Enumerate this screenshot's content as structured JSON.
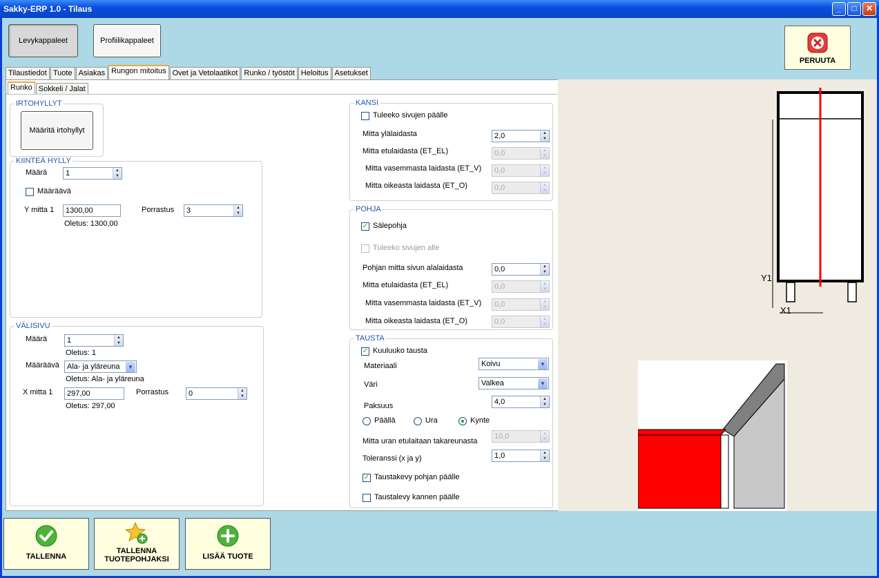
{
  "window": {
    "title": "Sakky-ERP 1.0 - Tilaus"
  },
  "top_buttons": {
    "levy": "Levykappaleet",
    "profiili": "Profiilikappaleet",
    "peruuta": "PERUUTA"
  },
  "main_tabs": [
    "Tilaustiedot",
    "Tuote",
    "Asiakas",
    "Rungon mitoitus",
    "Ovet ja Vetolaatikot",
    "Runko / työstöt",
    "Heloitus",
    "Asetukset"
  ],
  "sub_tabs": [
    "Runko",
    "Sokkeli / Jalat"
  ],
  "irtohyllyt": {
    "title": "IRTOHYLLYT",
    "button": "Määritä irtohyllyt"
  },
  "kiintea": {
    "title": "KIINTEÄ HYLLY",
    "maara_label": "Määrä",
    "maara_value": "1",
    "maaraava_label": "Määräävä",
    "ymitta_label": "Y mitta 1",
    "ymitta_value": "1300,00",
    "porrastus_label": "Porrastus",
    "porrastus_value": "3",
    "oletus": "Oletus: 1300,00"
  },
  "valisivu": {
    "title": "VÄLISIVU",
    "maara_label": "Määrä",
    "maara_value": "1",
    "maara_oletus": "Oletus: 1",
    "maaraava_label": "Määräävä",
    "maaraava_value": "Ala- ja yläreuna",
    "maaraava_oletus": "Oletus: Ala- ja yläreuna",
    "xmitta_label": "X mitta 1",
    "xmitta_value": "297,00",
    "porrastus_label": "Porrastus",
    "porrastus_value": "0",
    "xmitta_oletus": "Oletus: 297,00"
  },
  "kansi": {
    "title": "KANSI",
    "tuleeko": "Tuleeko sivujen päälle",
    "rows": [
      {
        "label": "Mitta ylälaidasta",
        "value": "2,0"
      },
      {
        "label": "Mitta etulaidasta (ET_EL)",
        "value": "0,0"
      },
      {
        "label": "Mitta vasemmasta laidasta (ET_V)",
        "value": "0,0"
      },
      {
        "label": "Mitta oikeasta laidasta (ET_O)",
        "value": "0,0"
      }
    ]
  },
  "pohja": {
    "title": "POHJA",
    "salepohja": "Sälepohja",
    "tuleeko": "Tuleeko sivujen alle",
    "rows": [
      {
        "label": "Pohjan mitta sivun alalaidasta",
        "value": "0,0"
      },
      {
        "label": "Mitta etulaidasta (ET_EL)",
        "value": "0,0"
      },
      {
        "label": "Mitta vasemmasta laidasta (ET_V)",
        "value": "0,0"
      },
      {
        "label": "Mitta oikeasta laidasta (ET_O)",
        "value": "0,0"
      }
    ]
  },
  "tausta": {
    "title": "TAUSTA",
    "kuuluuko": "Kuuluuko tausta",
    "materiaali_label": "Materiaali",
    "materiaali_value": "Koivu",
    "vari_label": "Väri",
    "vari_value": "Valkea",
    "paksuus_label": "Paksuus",
    "paksuus_value": "4,0",
    "radio_options": [
      "Päällä",
      "Ura",
      "Kynte"
    ],
    "mitta_uran_label": "Mitta uran etulaitaan takareunasta",
    "mitta_uran_value": "10,0",
    "toleranssi_label": "Toleranssi (x ja y)",
    "toleranssi_value": "1,0",
    "taustakevy": "Taustakevy pohjan päälle",
    "taustalevy": "Taustalevy kannen päälle"
  },
  "drawing": {
    "y_label": "Y1",
    "x_label": "X1"
  },
  "bottom_buttons": {
    "tallenna": "TALLENNA",
    "tuotepohja_1": "TALLENNA",
    "tuotepohja_2": "TUOTEPOHJAKSI",
    "lisaa": "LISÄÄ TUOTE"
  },
  "colors": {
    "accent_red": "#ff0000",
    "title_blue": "#0a4ee0",
    "panel_bg": "#add8e6",
    "group_title": "#2255aa",
    "check_green": "#21a121"
  }
}
